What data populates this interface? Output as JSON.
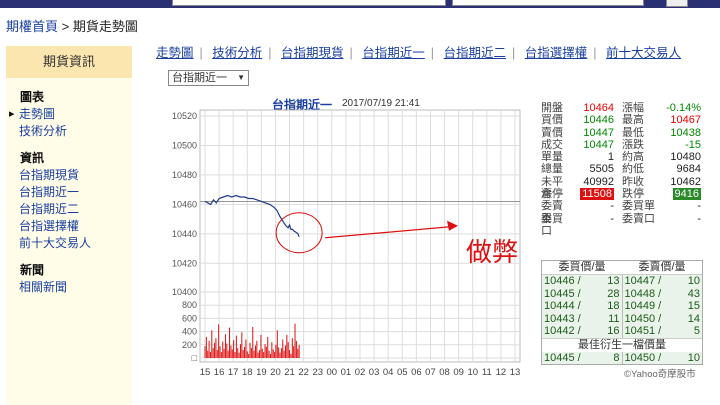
{
  "breadcrumb": {
    "home": "期權首頁",
    "sep": " > ",
    "current": "期貨走勢圖"
  },
  "sidebar": {
    "header": "期貨資訊",
    "sections": [
      {
        "title": "圖表",
        "items": [
          "走勢圖",
          "技術分析"
        ]
      },
      {
        "title": "資訊",
        "items": [
          "台指期現貨",
          "台指期近一",
          "台指期近二",
          "台指選擇權",
          "前十大交易人"
        ]
      },
      {
        "title": "新聞",
        "items": [
          "相關新聞"
        ]
      }
    ],
    "active": "走勢圖"
  },
  "topnav": [
    "走勢圖",
    "技術分析",
    "台指期現貨",
    "台指期近一",
    "台指期近二",
    "台指選擇權",
    "前十大交易人"
  ],
  "select": {
    "value": "台指期近一"
  },
  "chart_title": "台指期近一",
  "chart_time": "2017/07/19 21:41",
  "chart_data": {
    "type": "line",
    "x_ticks": [
      "15",
      "16",
      "17",
      "18",
      "19",
      "20",
      "21",
      "22",
      "23",
      "00",
      "01",
      "02",
      "03",
      "04",
      "05",
      "06",
      "07",
      "08",
      "09",
      "10",
      "11",
      "12",
      "13"
    ],
    "price_ticks": [
      10520,
      10500,
      10480,
      10460,
      10440,
      10420
    ],
    "volume_ticks": [
      "10400",
      "800",
      "600",
      "400",
      "200",
      "□"
    ],
    "ylim": [
      10410,
      10520
    ],
    "reference": 10462,
    "series": [
      {
        "x": [
          15.0,
          15.2,
          15.4,
          15.6,
          15.8,
          16.0,
          16.3,
          16.6,
          16.9,
          17.2,
          17.5,
          17.8,
          18.1,
          18.4,
          18.7,
          19.0,
          19.3,
          19.6,
          19.9,
          20.1,
          20.3,
          20.5,
          20.7,
          20.9,
          21.0,
          21.1,
          21.2,
          21.3,
          21.45,
          21.6,
          21.68
        ],
        "values": [
          10462,
          10461,
          10460,
          10463,
          10461,
          10464,
          10465,
          10466,
          10465,
          10466,
          10465,
          10465,
          10464,
          10464,
          10463,
          10462,
          10461,
          10460,
          10458,
          10456,
          10452,
          10449,
          10446,
          10444,
          10446,
          10443,
          10443,
          10442,
          10441,
          10440,
          10438
        ]
      }
    ],
    "volume": {
      "x_start": 15.0,
      "x_end": 21.68,
      "count": 70,
      "values": [
        180,
        320,
        110,
        260,
        90,
        420,
        150,
        230,
        300,
        120,
        510,
        180,
        90,
        250,
        140,
        360,
        220,
        110,
        460,
        190,
        130,
        270,
        90,
        340,
        150,
        80,
        210,
        390,
        120,
        170,
        280,
        100,
        60,
        230,
        150,
        470,
        110,
        190,
        260,
        80,
        120,
        350,
        140,
        90,
        210,
        170,
        320,
        110,
        60,
        240,
        130,
        90,
        200,
        420,
        160,
        80,
        150,
        280,
        110,
        190,
        350,
        240,
        120,
        60,
        300,
        180,
        520,
        260,
        140,
        200
      ]
    }
  },
  "quote": [
    {
      "l1": "開盤",
      "v1": "10464",
      "c1": "red",
      "l2": "漲幅",
      "v2": "-0.14%",
      "c2": "green"
    },
    {
      "l1": "買價",
      "v1": "10446",
      "c1": "green",
      "l2": "最高",
      "v2": "10467",
      "c2": "red"
    },
    {
      "l1": "賣價",
      "v1": "10447",
      "c1": "green",
      "l2": "最低",
      "v2": "10438",
      "c2": "green"
    },
    {
      "l1": "成交",
      "v1": "10447",
      "c1": "green",
      "l2": "漲跌",
      "v2": "-15",
      "c2": "green"
    },
    {
      "l1": "單量",
      "v1": "1",
      "c1": "black",
      "l2": "約高",
      "v2": "10480",
      "c2": "black"
    },
    {
      "l1": "總量",
      "v1": "5505",
      "c1": "black",
      "l2": "約低",
      "v2": "9684",
      "c2": "black"
    },
    {
      "l1": "未平倉",
      "v1": "40992",
      "c1": "black",
      "l2": "昨收",
      "v2": "10462",
      "c2": "black"
    },
    {
      "l1": "漲停",
      "v1": "11508",
      "c1": "lim-up",
      "l2": "跌停",
      "v2": "9416",
      "c2": "lim-dn"
    },
    {
      "l1": "委賣單",
      "v1": "-",
      "c1": "black",
      "l2": "委買單",
      "v2": "-",
      "c2": "black"
    },
    {
      "l1": "委買口",
      "v1": "-",
      "c1": "black",
      "l2": "委賣口",
      "v2": "-",
      "c2": "black"
    }
  ],
  "book": {
    "headers": [
      "委買價/量",
      "委賣價/量"
    ],
    "rows": [
      {
        "bp": "10446 /",
        "bq": "13",
        "ap": "10447 /",
        "aq": "10"
      },
      {
        "bp": "10445 /",
        "bq": "28",
        "ap": "10448 /",
        "aq": "43"
      },
      {
        "bp": "10444 /",
        "bq": "18",
        "ap": "10449 /",
        "aq": "15"
      },
      {
        "bp": "10443 /",
        "bq": "11",
        "ap": "10450 /",
        "aq": "14"
      },
      {
        "bp": "10442 /",
        "bq": "16",
        "ap": "10451 /",
        "aq": "5"
      }
    ],
    "best_label": "最佳衍生一檔價量",
    "best": {
      "bp": "10445 /",
      "bq": "8",
      "ap": "10450 /",
      "aq": "10"
    }
  },
  "copyright": "©Yahoo奇摩股市",
  "callout": "做弊",
  "colors": {
    "line": "#1e3a8a",
    "volume": "#d11",
    "arrow": "#d11",
    "grid": "#ddd",
    "reference": "#888"
  }
}
